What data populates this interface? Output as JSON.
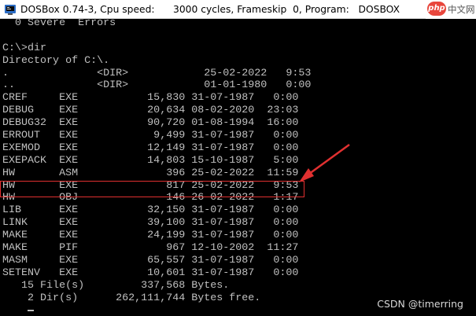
{
  "window": {
    "title": "DOSBox 0.74-3, Cpu speed:      3000 cycles, Frameskip  0, Program:   DOSBOX",
    "icon": "dosbox-icon"
  },
  "console": {
    "lines": [
      "  0 Severe  Errors",
      "",
      "C:\\>dir",
      "Directory of C:\\.",
      ".              <DIR>            25-02-2022   9:53",
      "..             <DIR>            01-01-1980   0:00",
      "CREF     EXE           15,830 31-07-1987   0:00",
      "DEBUG    EXE           20,634 08-02-2020  23:03",
      "DEBUG32  EXE           90,720 01-08-1994  16:00",
      "ERROUT   EXE            9,499 31-07-1987   0:00",
      "EXEMOD   EXE           12,149 31-07-1987   0:00",
      "EXEPACK  EXE           14,803 15-10-1987   5:00",
      "HW       ASM              396 25-02-2022  11:59",
      "HW       EXE              817 25-02-2022   9:53",
      "HW       OBJ              146 26-02-2022   1:17",
      "LIB      EXE           32,150 31-07-1987   0:00",
      "LINK     EXE           39,100 31-07-1987   0:00",
      "MAKE     EXE           24,199 31-07-1987   0:00",
      "MAKE     PIF              967 12-10-2002  11:27",
      "MASM     EXE           65,557 31-07-1987   0:00",
      "SETENV   EXE           10,601 31-07-1987   0:00",
      "   15 File(s)         337,568 Bytes.",
      "    2 Dir(s)      262,111,744 Bytes free.",
      "",
      "C:\\>"
    ]
  },
  "annotations": {
    "highlight_color": "#e03030",
    "arrow_color": "#e03030"
  },
  "watermarks": {
    "top_right_logo": "php中文网",
    "bottom_right": "CSDN @timerring"
  },
  "colors": {
    "console_bg": "#000000",
    "console_text": "#c0c0c0",
    "titlebar_bg": "#ffffff"
  }
}
